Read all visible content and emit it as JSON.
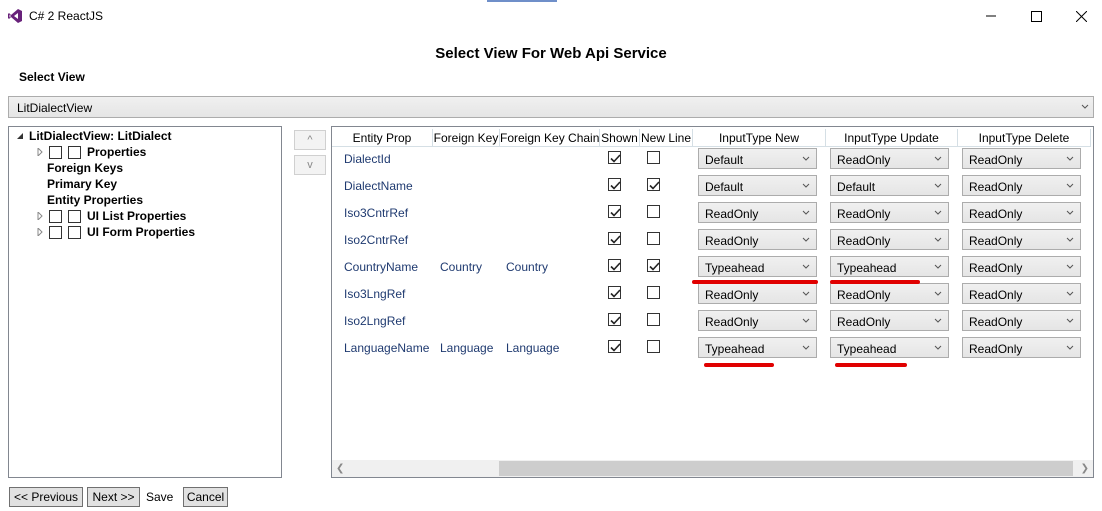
{
  "window": {
    "title": "C# 2 ReactJS",
    "minimize_glyph": "—",
    "maximize_glyph": "□",
    "close_glyph": "✕"
  },
  "page": {
    "title": "Select View For Web Api Service",
    "select_view_label": "Select View",
    "selected_view": "LitDialectView"
  },
  "tree": {
    "root": "LitDialectView: LitDialect",
    "items": {
      "properties": "Properties",
      "foreign_keys": "Foreign Keys",
      "primary_key": "Primary Key",
      "entity_properties": "Entity Properties",
      "ui_list_properties": "UI List Properties",
      "ui_form_properties": "UI Form Properties"
    }
  },
  "move_buttons": {
    "up": "^",
    "down": "v"
  },
  "grid": {
    "headers": {
      "entity_prop": "Entity Prop",
      "foreign_key": "Foreign Key",
      "foreign_key_chain": "Foreign Key Chain",
      "shown": "Shown",
      "new_line": "New Line",
      "input_new": "InputType New",
      "input_update": "InputType Update",
      "input_delete": "InputType Delete"
    },
    "rows": [
      {
        "entity_prop": "DialectId",
        "foreign_key": "",
        "foreign_key_chain": "",
        "shown": true,
        "new_line": false,
        "input_new": "Default",
        "input_update": "ReadOnly",
        "input_delete": "ReadOnly"
      },
      {
        "entity_prop": "DialectName",
        "foreign_key": "",
        "foreign_key_chain": "",
        "shown": true,
        "new_line": true,
        "input_new": "Default",
        "input_update": "Default",
        "input_delete": "ReadOnly"
      },
      {
        "entity_prop": "Iso3CntrRef",
        "foreign_key": "",
        "foreign_key_chain": "",
        "shown": true,
        "new_line": false,
        "input_new": "ReadOnly",
        "input_update": "ReadOnly",
        "input_delete": "ReadOnly"
      },
      {
        "entity_prop": "Iso2CntrRef",
        "foreign_key": "",
        "foreign_key_chain": "",
        "shown": true,
        "new_line": false,
        "input_new": "ReadOnly",
        "input_update": "ReadOnly",
        "input_delete": "ReadOnly"
      },
      {
        "entity_prop": "CountryName",
        "foreign_key": "Country",
        "foreign_key_chain": "Country",
        "shown": true,
        "new_line": true,
        "input_new": "Typeahead",
        "input_update": "Typeahead",
        "input_delete": "ReadOnly"
      },
      {
        "entity_prop": "Iso3LngRef",
        "foreign_key": "",
        "foreign_key_chain": "",
        "shown": true,
        "new_line": false,
        "input_new": "ReadOnly",
        "input_update": "ReadOnly",
        "input_delete": "ReadOnly"
      },
      {
        "entity_prop": "Iso2LngRef",
        "foreign_key": "",
        "foreign_key_chain": "",
        "shown": true,
        "new_line": false,
        "input_new": "ReadOnly",
        "input_update": "ReadOnly",
        "input_delete": "ReadOnly"
      },
      {
        "entity_prop": "LanguageName",
        "foreign_key": "Language",
        "foreign_key_chain": "Language",
        "shown": true,
        "new_line": false,
        "input_new": "Typeahead",
        "input_update": "Typeahead",
        "input_delete": "ReadOnly"
      }
    ]
  },
  "footer": {
    "previous": "<< Previous",
    "next": "Next >>",
    "save": "Save",
    "cancel": "Cancel"
  },
  "colors": {
    "link_text": "#1f3a70",
    "annotation": "#e00000",
    "app_icon": "#68217a"
  }
}
